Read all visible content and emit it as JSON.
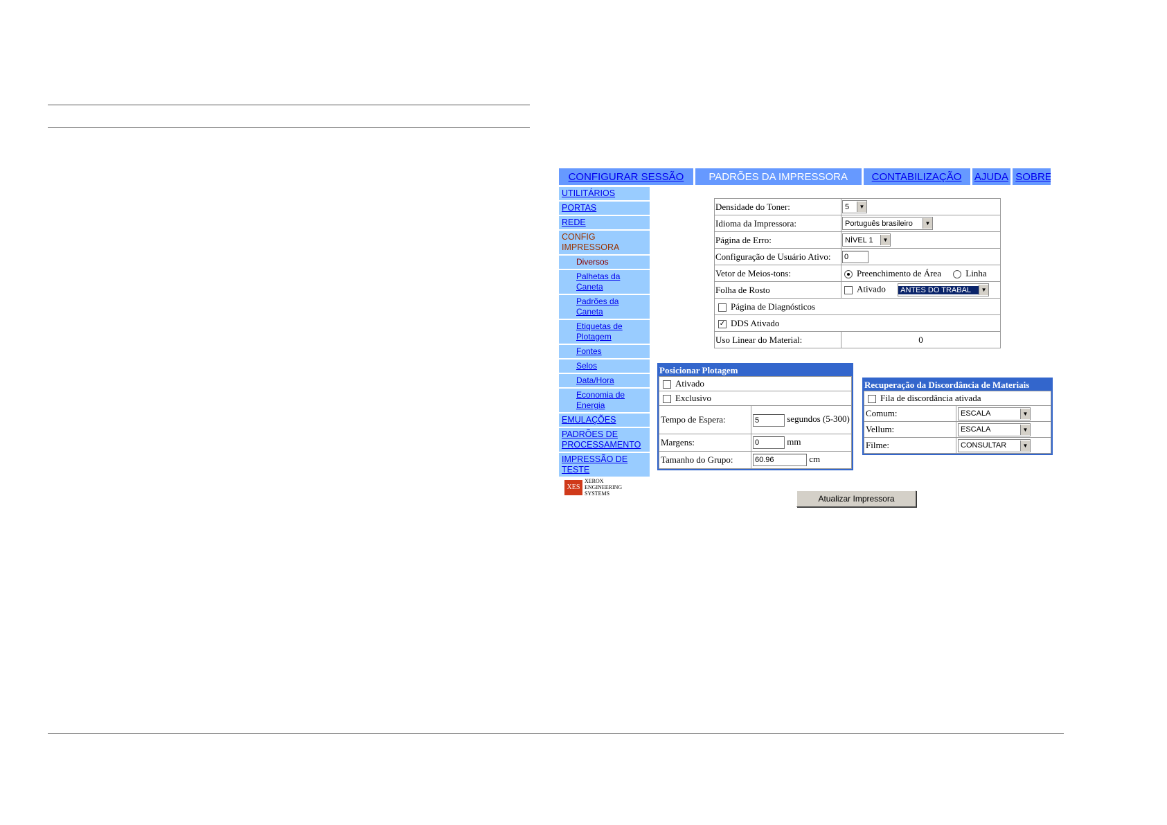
{
  "tabs": [
    {
      "label": "CONFIGURAR SESSÃO",
      "active": false
    },
    {
      "label": "PADRÕES DA IMPRESSORA",
      "active": true
    },
    {
      "label": "CONTABILIZAÇÃO",
      "active": false
    },
    {
      "label": "AJUDA",
      "active": false
    },
    {
      "label": "SOBRE",
      "active": false
    }
  ],
  "sidebar": {
    "utilitarios": "UTILITÁRIOS",
    "portas": "PORTAS",
    "rede": "REDE",
    "config_impressora": "CONFIG IMPRESSORA",
    "diversos": "Diversos",
    "palhetas": "Palhetas da Caneta",
    "padroes_caneta": "Padrões da Caneta",
    "etiquetas": "Etiquetas de Plotagem",
    "fontes": "Fontes",
    "selos": "Selos",
    "data_hora": "Data/Hora",
    "economia": "Economia de Energia",
    "emulacoes": "EMULAÇÕES",
    "padroes_proc": "PADRÕES DE PROCESSAMENTO",
    "impressao_teste": "IMPRESSÃO DE TESTE"
  },
  "logo": {
    "abbr": "XES",
    "line1": "XEROX",
    "line2": "ENGINEERING",
    "line3": "SYSTEMS"
  },
  "main": {
    "toner_label": "Densidade do Toner:",
    "toner_value": "5",
    "idioma_label": "Idioma da Impressora:",
    "idioma_value": "Português brasileiro",
    "erro_label": "Página de Erro:",
    "erro_value": "NÍVEL 1",
    "usuario_label": "Configuração de Usuário Ativo:",
    "usuario_value": "0",
    "vetor_label": "Vetor de Meios-tons:",
    "vetor_opt1": "Preenchimento de Área",
    "vetor_opt2": "Linha",
    "folha_label": "Folha de Rosto",
    "folha_ativado": "Ativado",
    "folha_value": "ANTES DO TRABAL",
    "diagnosticos": "Página de Diagnósticos",
    "dds": "DDS Ativado",
    "uso_label": "Uso Linear do Material:",
    "uso_value": "0"
  },
  "posicionar": {
    "title": "Posicionar Plotagem",
    "ativado": "Ativado",
    "exclusivo": "Exclusivo",
    "espera_label": "Tempo de Espera:",
    "espera_value": "5",
    "espera_unit": "segundos (5-300)",
    "margens_label": "Margens:",
    "margens_value": "0",
    "margens_unit": "mm",
    "grupo_label": "Tamanho do Grupo:",
    "grupo_value": "60.96",
    "grupo_unit": "cm"
  },
  "recuperacao": {
    "title": "Recuperação da Discordância de Materiais",
    "fila": "Fila de discordância ativada",
    "comum_label": "Comum:",
    "comum_value": "ESCALA",
    "vellum_label": "Vellum:",
    "vellum_value": "ESCALA",
    "filme_label": "Filme:",
    "filme_value": "CONSULTAR"
  },
  "button": {
    "label": "Atualizar Impressora"
  },
  "colors": {
    "tab_bg": "#6699ff",
    "sidebar_bg": "#99ccff",
    "panel_border": "#3366cc",
    "link": "#0000ee"
  }
}
